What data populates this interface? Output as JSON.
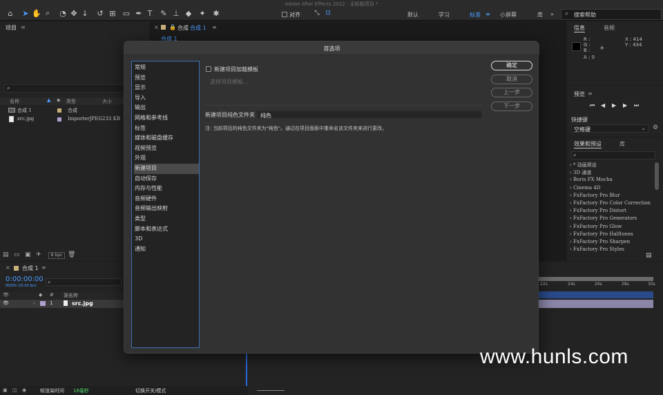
{
  "app_title": "Adobe After Effects 2022 - 无标题项目 *",
  "toolbar": {
    "align_label": "对齐",
    "workspaces": [
      "默认",
      "学习",
      "标准",
      "小屏幕",
      "库"
    ],
    "search_placeholder": "搜索帮助"
  },
  "project_panel": {
    "title": "项目",
    "columns": [
      "名称",
      "类型",
      "大小"
    ],
    "items": [
      {
        "name": "合成 1",
        "type": "合成",
        "size": ""
      },
      {
        "name": "src.jpg",
        "type": "ImporterJPEG",
        "size": "233 KB"
      }
    ],
    "bpc": "8 bpc"
  },
  "comp_panel": {
    "close": "×",
    "tab_prefix": "合成",
    "tab_name": "合成 1",
    "sub_tab": "合成 1"
  },
  "info_panel": {
    "tabs": [
      "信息",
      "音频"
    ],
    "r": "R :",
    "g": "G :",
    "b": "B :",
    "a": "A : 0",
    "x": "X : 414",
    "y": "Y : 434"
  },
  "preview_panel": {
    "title": "预览",
    "shortcut_label": "快捷键",
    "shortcut_value": "空格键"
  },
  "effects_panel": {
    "tabs": [
      "效果和预设",
      "库"
    ],
    "items": [
      "* 动画预设",
      "3D 通道",
      "Boris FX Mocha",
      "Cinema 4D",
      "FxFactory Pro Blur",
      "FxFactory Pro Color Correction",
      "FxFactory Pro Distort",
      "FxFactory Pro Generators",
      "FxFactory Pro Glow",
      "FxFactory Pro Halftones",
      "FxFactory Pro Sharpen",
      "FxFactory Pro Styles"
    ]
  },
  "timeline": {
    "tab": "合成 1",
    "timecode": "0:00:00:00",
    "fps": "00000 (25.00 fps)",
    "col_source": "源名称",
    "layer_num": "1",
    "layer_name": "src.jpg",
    "ruler": [
      "22s",
      "24s",
      "26s",
      "28s",
      "30s"
    ],
    "render_label": "帧渲染时间",
    "render_value": "16毫秒",
    "toggle_label": "切换开关/模式"
  },
  "dialog": {
    "title": "首选项",
    "categories": [
      "常规",
      "预览",
      "显示",
      "导入",
      "输出",
      "网格和参考线",
      "标签",
      "媒体和磁盘缓存",
      "视频预览",
      "外观",
      "新建项目",
      "自动保存",
      "内存与性能",
      "音频硬件",
      "音频输出映射",
      "类型",
      "脚本和表达式",
      "3D",
      "通知"
    ],
    "selected_index": 10,
    "template_checkbox": "新建项目加载模板",
    "template_button": "选择项目模板...",
    "folder_label": "新建项目纯色文件夹",
    "folder_value": "纯色",
    "note": "注: 当前项目的纯色文件夹为\"纯色\"。通过在项目面板中重命名该文件夹来进行更改。",
    "ok": "确定",
    "cancel": "取消",
    "prev": "上一步",
    "next": "下一步"
  },
  "watermark": "www.hunls.com"
}
